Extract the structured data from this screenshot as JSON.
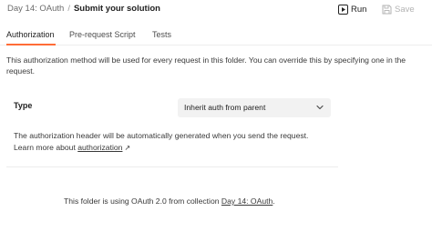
{
  "header": {
    "breadcrumb_parent": "Day 14: OAuth",
    "breadcrumb_separator": "/",
    "title": "Submit your solution",
    "run_label": "Run",
    "save_label": "Save"
  },
  "tabs": [
    {
      "label": "Authorization",
      "active": true
    },
    {
      "label": "Pre-request Script",
      "active": false
    },
    {
      "label": "Tests",
      "active": false
    }
  ],
  "auth": {
    "description": "This authorization method will be used for every request in this folder. You can override this by specifying one in the request.",
    "type_label": "Type",
    "type_value": "Inherit auth from parent",
    "info_text": "The authorization header will be automatically generated when you send the request. Learn more about",
    "info_link": "authorization",
    "info_link_arrow": "↗",
    "footer_text": "This folder is using OAuth 2.0 from collection",
    "footer_link": "Day 14: OAuth",
    "footer_end": "."
  },
  "colors": {
    "accent": "#ff6c37",
    "select_bg": "#f2f2f2",
    "disabled": "#b3b3b3"
  }
}
